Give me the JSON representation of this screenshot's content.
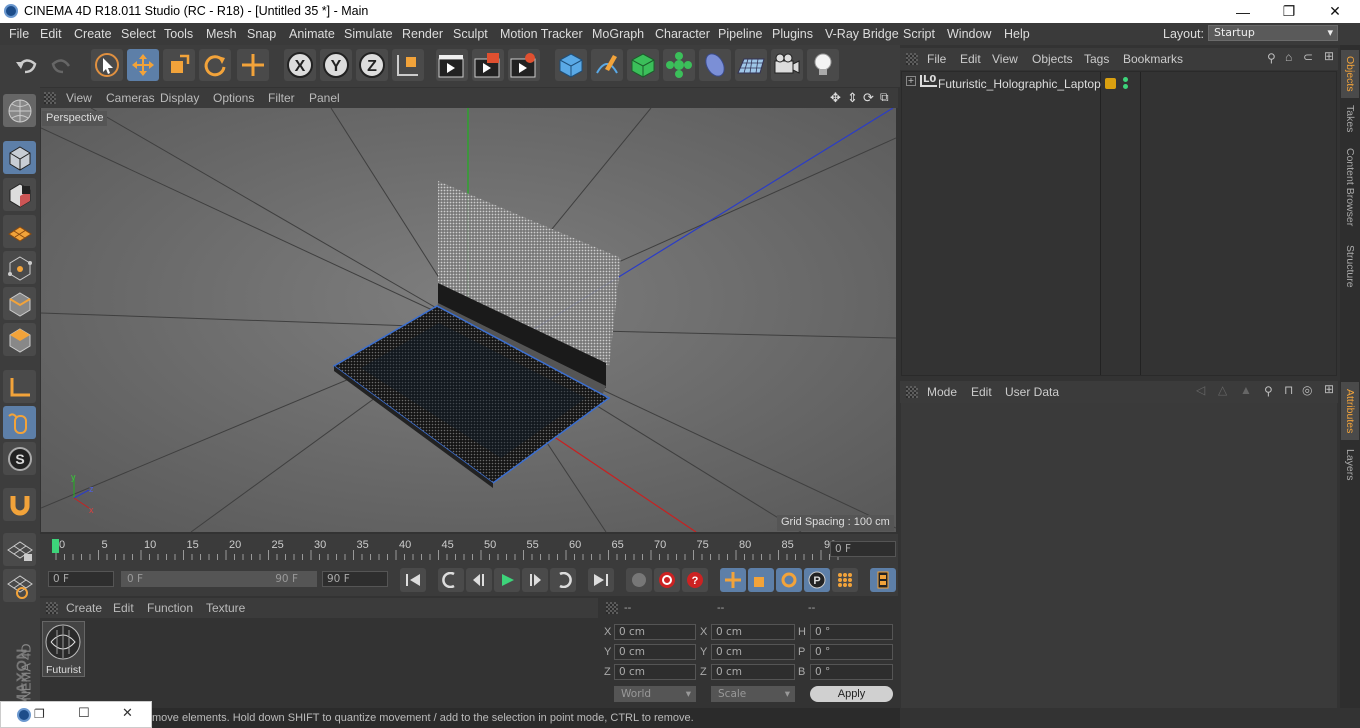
{
  "window": {
    "title": "CINEMA 4D R18.011 Studio (RC - R18) - [Untitled 35 *] - Main",
    "minimize": "—",
    "maximize": "❐",
    "close": "✕"
  },
  "menu": [
    "File",
    "Edit",
    "Create",
    "Select",
    "Tools",
    "Mesh",
    "Snap",
    "Animate",
    "Simulate",
    "Render",
    "Sculpt",
    "Motion Tracker",
    "MoGraph",
    "Character",
    "Pipeline",
    "Plugins",
    "V-Ray Bridge",
    "Script",
    "Window",
    "Help"
  ],
  "layout": {
    "label": "Layout:",
    "value": "Startup"
  },
  "viewport": {
    "menu": [
      "View",
      "Cameras",
      "Display",
      "Options",
      "Filter",
      "Panel"
    ],
    "camera_label": "Perspective",
    "grid_spacing": "Grid Spacing : 100 cm"
  },
  "timeline": {
    "ticks": [
      "0",
      "5",
      "10",
      "15",
      "20",
      "25",
      "30",
      "35",
      "40",
      "45",
      "50",
      "55",
      "60",
      "65",
      "70",
      "75",
      "80",
      "85",
      "90"
    ],
    "current_frame": "0 F",
    "start_field": "0 F",
    "range_start": "0 F",
    "range_end": "90 F",
    "end_field": "90 F"
  },
  "materials": {
    "menu": [
      "Create",
      "Edit",
      "Function",
      "Texture"
    ],
    "items": [
      {
        "name": "Futurist"
      }
    ]
  },
  "coordinates": {
    "headers": [
      "--",
      "--",
      "--"
    ],
    "rows": [
      {
        "a": "X",
        "av": "0 cm",
        "b": "X",
        "bv": "0 cm",
        "c": "H",
        "cv": "0 °"
      },
      {
        "a": "Y",
        "av": "0 cm",
        "b": "Y",
        "bv": "0 cm",
        "c": "P",
        "cv": "0 °"
      },
      {
        "a": "Z",
        "av": "0 cm",
        "b": "Z",
        "bv": "0 cm",
        "c": "B",
        "cv": "0 °"
      }
    ],
    "mode1": "World",
    "mode2": "Scale",
    "apply": "Apply"
  },
  "objects": {
    "menu": [
      "File",
      "Edit",
      "View",
      "Objects",
      "Tags",
      "Bookmarks"
    ],
    "items": [
      {
        "name": "Futuristic_Holographic_Laptop",
        "badge": "L0"
      }
    ]
  },
  "attributes": {
    "menu": [
      "Mode",
      "Edit",
      "User Data"
    ]
  },
  "side_tabs_top": [
    "Objects",
    "Takes",
    "Content Browser",
    "Structure"
  ],
  "side_tabs_bottom": [
    "Attributes",
    "Layers"
  ],
  "status": "move elements. Hold down SHIFT to quantize movement / add to the selection in point mode, CTRL to remove.",
  "brand": {
    "maxon": "MAXON",
    "c4d": "CINEMA 4D"
  },
  "colors": {
    "accent": "#5d7fa8",
    "viewport_bg": "#6c6c6c",
    "x_axis": "#d02020",
    "y_axis": "#20b020",
    "z_axis": "#2040d0"
  }
}
